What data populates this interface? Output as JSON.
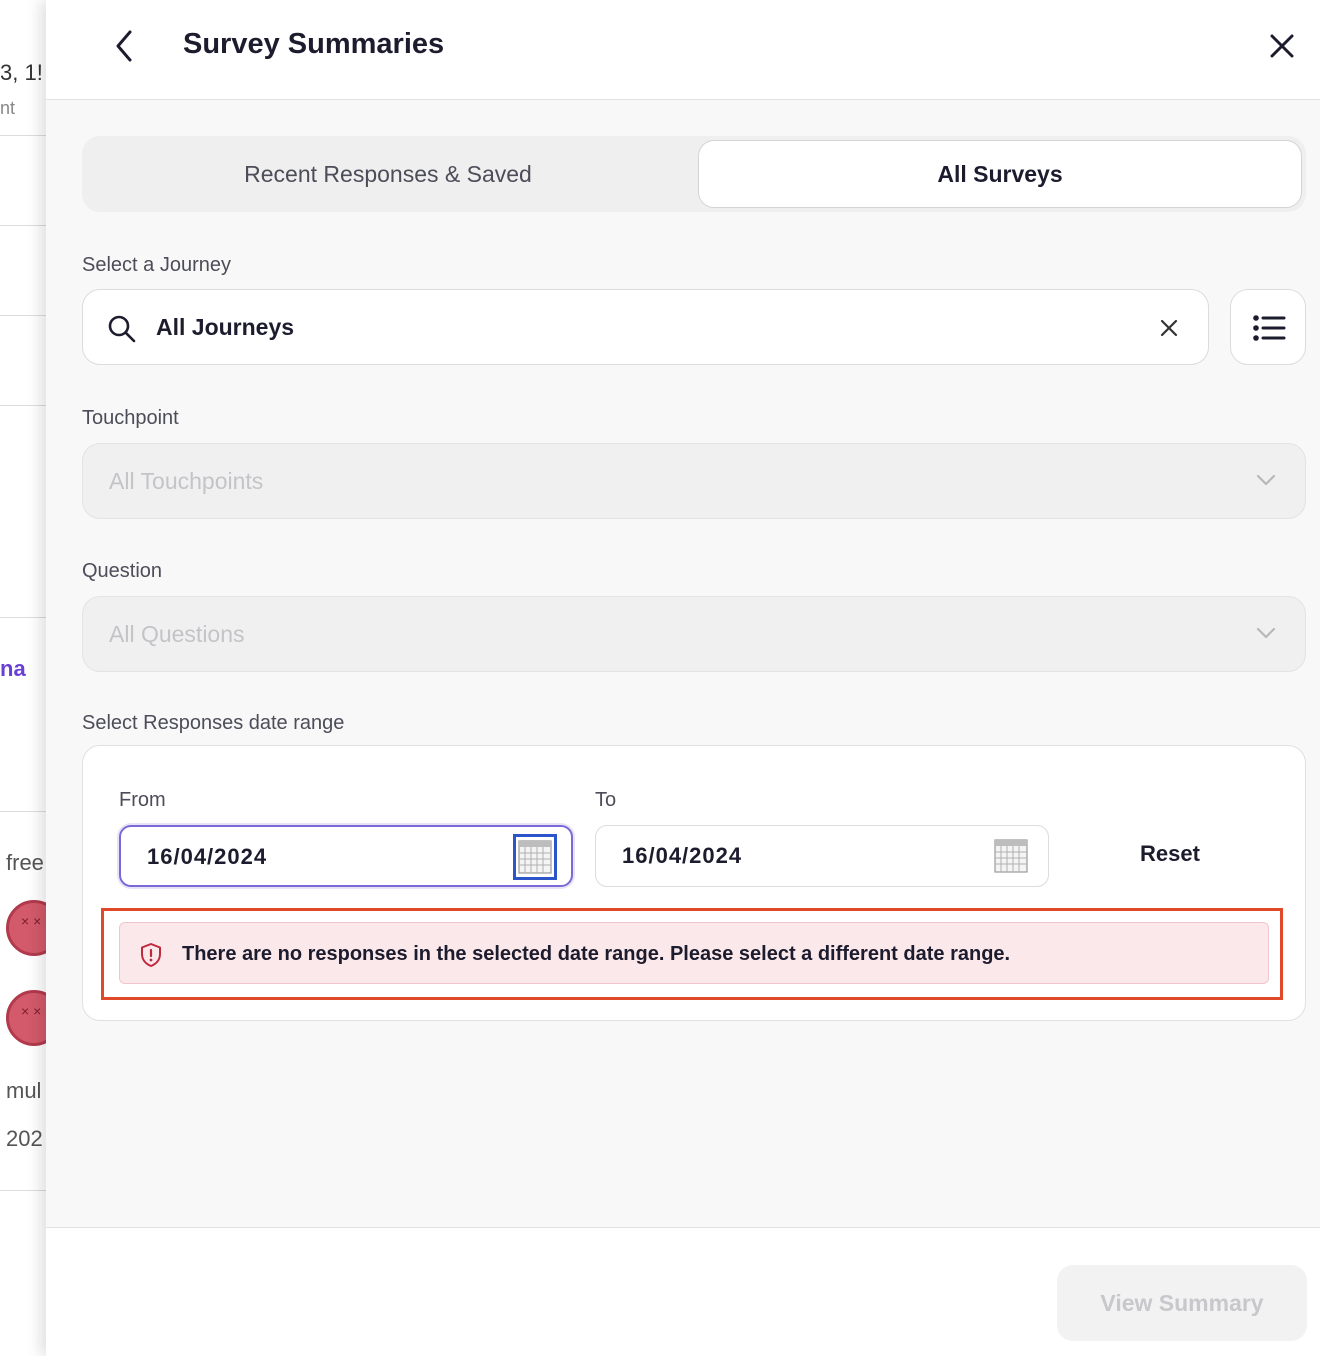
{
  "background": {
    "row1_text": "3, 1!",
    "row1_sub": "nt",
    "link_text": "na",
    "free_text": "free",
    "mult_text": "mul",
    "year_text": "202"
  },
  "header": {
    "title": "Survey Summaries",
    "back_icon": "chevron-left-icon",
    "close_icon": "close-icon"
  },
  "tabs": [
    {
      "label": "Recent Responses & Saved",
      "active": false
    },
    {
      "label": "All Surveys",
      "active": true
    }
  ],
  "journey": {
    "label": "Select a Journey",
    "value": "All Journeys"
  },
  "touchpoint": {
    "label": "Touchpoint",
    "value": "All Touchpoints"
  },
  "question": {
    "label": "Question",
    "value": "All Questions"
  },
  "date_range": {
    "label": "Select Responses date range",
    "from_label": "From",
    "from_value": "16/04/2024",
    "to_label": "To",
    "to_value": "16/04/2024",
    "reset_label": "Reset"
  },
  "alert": {
    "message": "There are no responses in the selected date range. Please select a different date range."
  },
  "footer": {
    "view_summary_label": "View Summary"
  },
  "colors": {
    "accent": "#7a6ad8",
    "error_border": "#e04a2a",
    "error_bg": "#fbe8ea",
    "link": "#6b3fd6"
  }
}
